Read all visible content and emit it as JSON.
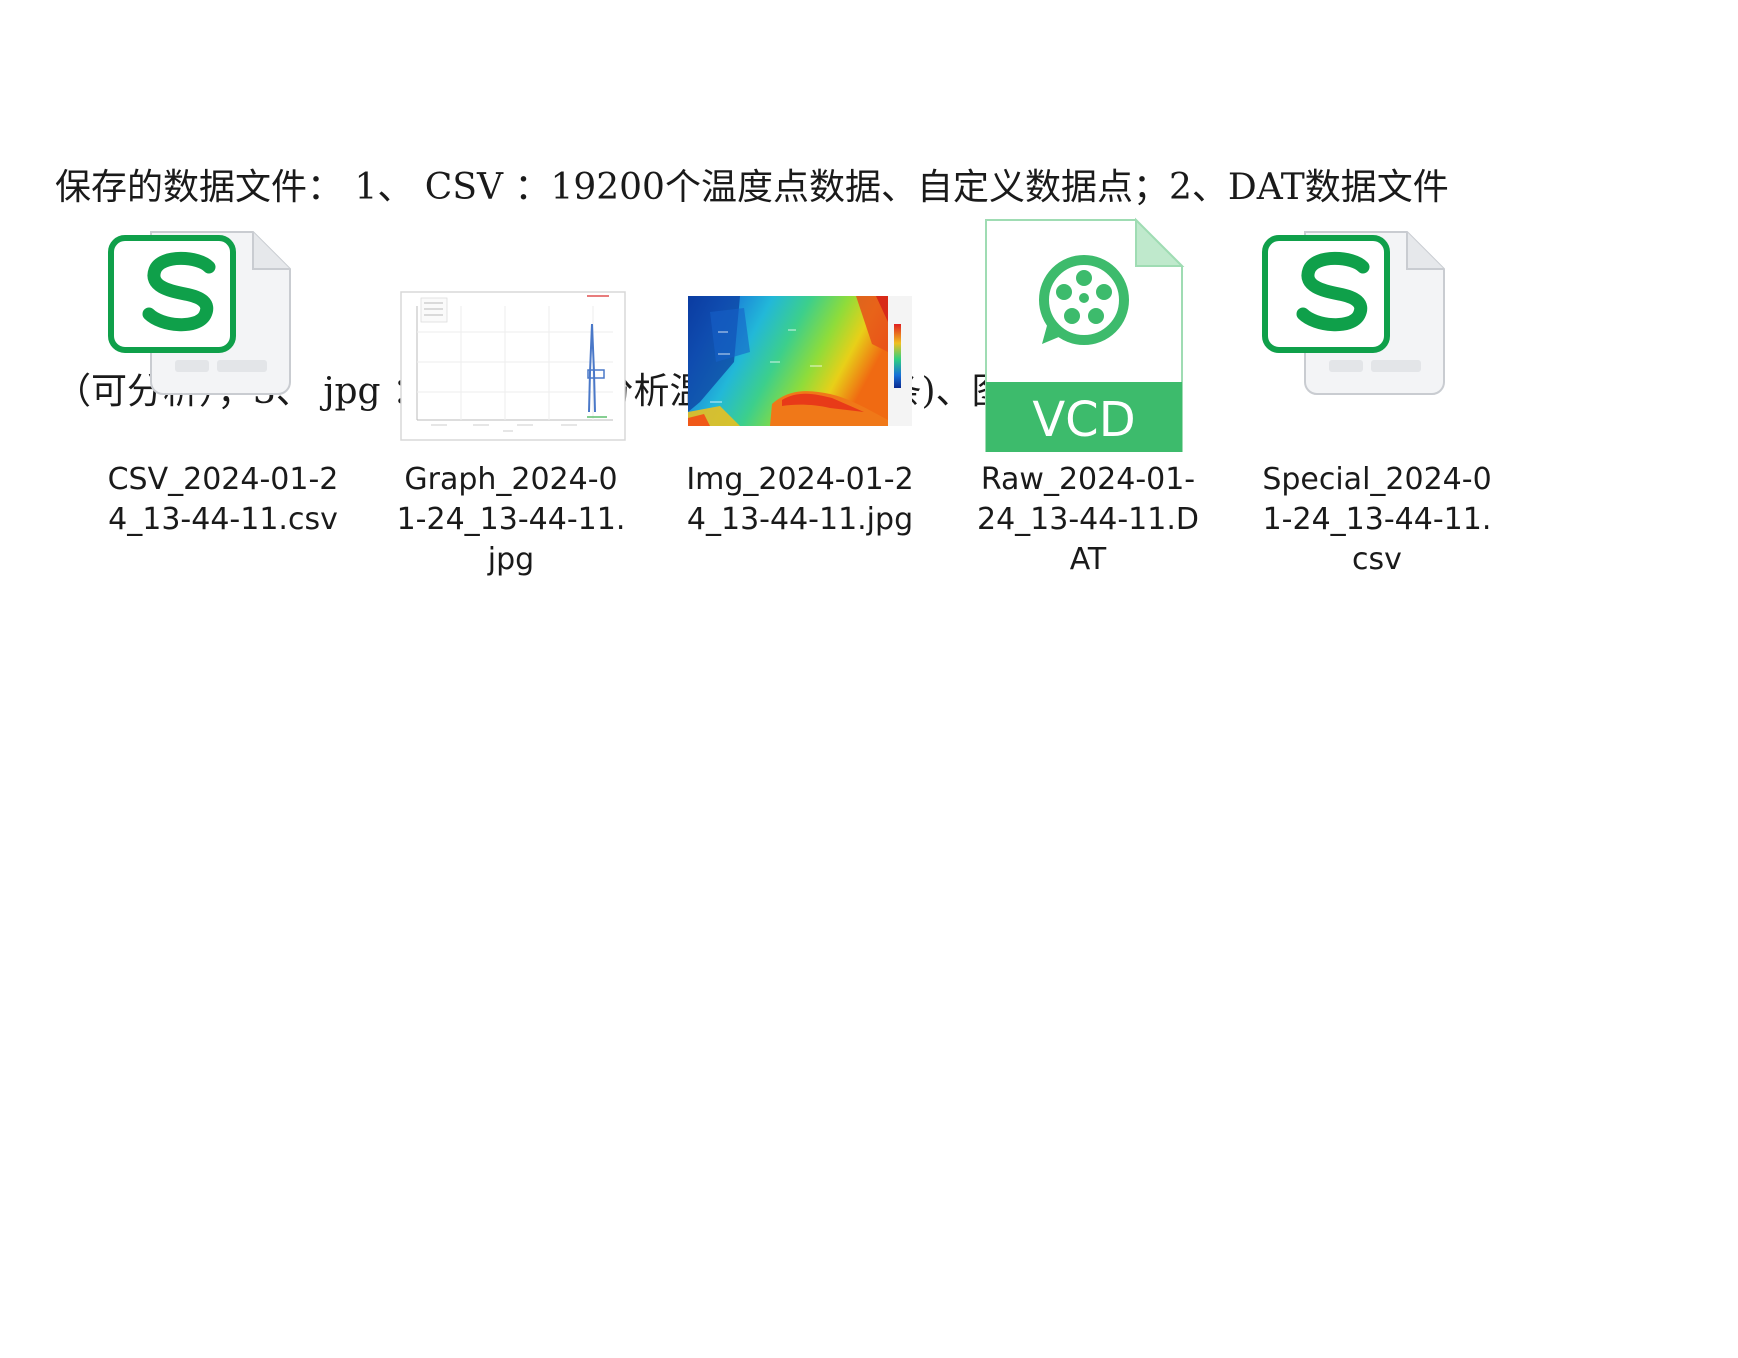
{
  "description": {
    "line1": "保存的数据文件： 1、 CSV ：19200个温度点数据、自定义数据点；2、DAT数据文件",
    "line2": "（可分析）；3、 jpg ： 热力图(带分析温度点、色卡条)、图表"
  },
  "files": [
    {
      "name": "CSV_2024-01-24_13-44-11.csv",
      "icon": "spreadsheet-s-icon"
    },
    {
      "name": "Graph_2024-01-24_13-44-11.jpg",
      "icon": "graph-thumbnail"
    },
    {
      "name": "Img_2024-01-24_13-44-11.jpg",
      "icon": "thermal-image-thumbnail"
    },
    {
      "name": "Raw_2024-01-24_13-44-11.DAT",
      "icon": "vcd-video-file-icon",
      "badge": "VCD"
    },
    {
      "name": "Special_2024-01-24_13-44-11.csv",
      "icon": "spreadsheet-s-icon"
    }
  ],
  "colors": {
    "spreadsheet_green": "#0fa04a",
    "vcd_green": "#3dbb6c",
    "page_gray": "#f2f3f5"
  }
}
